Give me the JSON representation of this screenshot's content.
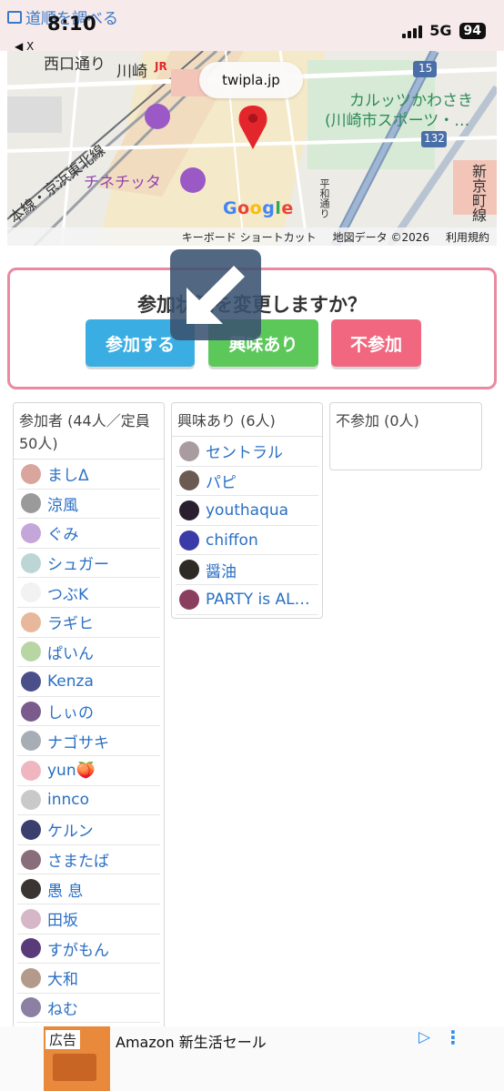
{
  "status_bar": {
    "back_link": "道順を調べる",
    "time": "8:10",
    "back_label": "◀ X",
    "network": "5G",
    "battery": "94"
  },
  "map": {
    "url": "twipla.jp",
    "labels": {
      "nishiguchi": "西口通り",
      "kawasaki": "川崎",
      "jr": "JR",
      "karuttsu": "カルッツかわさき",
      "sports": "(川崎市スポーツ・…",
      "route15": "15",
      "route132": "132",
      "cinecitta": "チネチッタ",
      "keihin": "本線・京浜東北線",
      "heiwa": "平和通り",
      "shinmachi": "新京町線"
    },
    "footer": {
      "shortcuts": "キーボード ショートカット",
      "map_data": "地図データ ©2026",
      "terms": "利用規約"
    },
    "google": "Google"
  },
  "rsvp": {
    "question": "参加状況を変更しますか？",
    "join": "参加する",
    "interested": "興味あり",
    "decline": "不参加"
  },
  "columns": {
    "attending": {
      "header": "参加者 (44人／定員50人)",
      "members": [
        {
          "name": "ましΔ",
          "avatar_color": "#d9a59c"
        },
        {
          "name": "涼風",
          "avatar_color": "#9a9a9a"
        },
        {
          "name": "ぐみ",
          "avatar_color": "#c5a6d8"
        },
        {
          "name": "シュガー",
          "avatar_color": "#bcd6d8"
        },
        {
          "name": "つぶK",
          "avatar_color": "#f2f2f2"
        },
        {
          "name": "ラギヒ",
          "avatar_color": "#e7b89b"
        },
        {
          "name": "ぱいん",
          "avatar_color": "#b7d6a4"
        },
        {
          "name": "Kenza",
          "avatar_color": "#4a4f8a"
        },
        {
          "name": "しぃの",
          "avatar_color": "#7b5a8c"
        },
        {
          "name": "ナゴサキ",
          "avatar_color": "#a7adb4"
        },
        {
          "name": "yun🍑",
          "avatar_color": "#f0b6c0"
        },
        {
          "name": "innco",
          "avatar_color": "#c9c9c9"
        },
        {
          "name": "ケルン",
          "avatar_color": "#3b3f6e"
        },
        {
          "name": "さまたば",
          "avatar_color": "#8a6d7a"
        },
        {
          "name": "愚 息",
          "avatar_color": "#3a3532"
        },
        {
          "name": "田坂",
          "avatar_color": "#d6b7c8"
        },
        {
          "name": "すがもん",
          "avatar_color": "#5a3b7a"
        },
        {
          "name": "大和",
          "avatar_color": "#b49a8a"
        },
        {
          "name": "ねむ",
          "avatar_color": "#8b7fa3"
        }
      ]
    },
    "interested": {
      "header": "興味あり (6人)",
      "members": [
        {
          "name": "セントラル",
          "avatar_color": "#a89ca0"
        },
        {
          "name": "パピ",
          "avatar_color": "#6a5a52"
        },
        {
          "name": "youthaqua",
          "avatar_color": "#2a1f2e"
        },
        {
          "name": "chiffon",
          "avatar_color": "#3a3aa8"
        },
        {
          "name": "醤油",
          "avatar_color": "#2e2a26"
        },
        {
          "name": "PARTY is AL…",
          "avatar_color": "#8a3f5e"
        }
      ]
    },
    "declined": {
      "header": "不参加 (0人)",
      "members": []
    }
  },
  "ad": {
    "tag": "広告",
    "title": "Amazon 新生活セール",
    "play_icon": "▷",
    "more_icon": "⋮"
  },
  "colors": {
    "join": "#3aaee2",
    "interested": "#5cc85a",
    "decline": "#f1677f",
    "frame": "#e98aa0",
    "link": "#2a6fc4"
  }
}
